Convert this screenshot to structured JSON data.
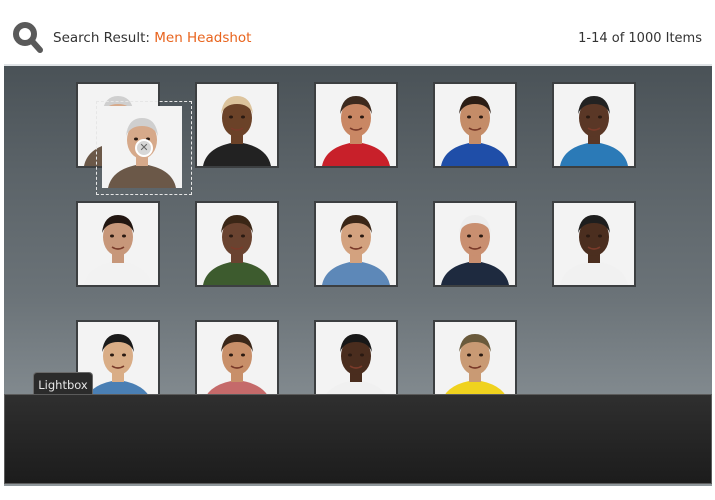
{
  "search": {
    "label": "Search Result:",
    "term": "Men Headshot",
    "count": "1-14 of 1000 Items"
  },
  "lightbox": {
    "label": "Lightbox"
  },
  "results": [
    {
      "name": "thumb-man-gray-hair",
      "skin": "#d6a98a",
      "hair": "#cfcfcf",
      "shirt": "#6b5848",
      "bg": "#f3f3f3"
    },
    {
      "name": "thumb-man-straw-hat",
      "skin": "#6b4228",
      "hair": "#dcc39c",
      "shirt": "#222222",
      "bg": "#f3f3f3"
    },
    {
      "name": "thumb-man-red-shirt",
      "skin": "#c98764",
      "hair": "#3d2a1e",
      "shirt": "#c8202a",
      "bg": "#f3f3f3"
    },
    {
      "name": "thumb-man-blue-jersey",
      "skin": "#c48c68",
      "hair": "#2b1d15",
      "shirt": "#1f4ea8",
      "bg": "#f3f3f3"
    },
    {
      "name": "thumb-man-dreadlocks-blue",
      "skin": "#5a3726",
      "hair": "#222222",
      "shirt": "#2b7ab7",
      "bg": "#f3f3f3"
    },
    {
      "name": "thumb-man-white-shirt",
      "skin": "#c7977a",
      "hair": "#221611",
      "shirt": "#f2f2f2",
      "bg": "#f3f3f3"
    },
    {
      "name": "thumb-man-striped-shirt",
      "skin": "#6a4330",
      "hair": "#3a2616",
      "shirt": "#3d5b2e",
      "bg": "#f3f3f3"
    },
    {
      "name": "thumb-man-denim-shirt",
      "skin": "#d3a27f",
      "hair": "#3a2617",
      "shirt": "#5d88b8",
      "bg": "#f3f3f3"
    },
    {
      "name": "thumb-man-white-mustache",
      "skin": "#c98f70",
      "hair": "#ededed",
      "shirt": "#1e2a3f",
      "bg": "#f3f3f3"
    },
    {
      "name": "thumb-man-long-dreads",
      "skin": "#4b2e1f",
      "hair": "#1e1e1e",
      "shirt": "#f1f1f1",
      "bg": "#f3f3f3"
    },
    {
      "name": "thumb-man-patterned-shirt",
      "skin": "#d9ad86",
      "hair": "#1a1a1a",
      "shirt": "#4a7fb4",
      "bg": "#f3f3f3"
    },
    {
      "name": "thumb-man-pink-shirt",
      "skin": "#c88f69",
      "hair": "#3a2719",
      "shirt": "#c56a6a",
      "bg": "#f3f3f3"
    },
    {
      "name": "thumb-man-tank-top",
      "skin": "#4a2d1e",
      "hair": "#181818",
      "shirt": "#f0f0f0",
      "bg": "#f3f3f3"
    },
    {
      "name": "thumb-man-cap-yellow",
      "skin": "#c99a74",
      "hair": "#6a5a3c",
      "shirt": "#f0d21e",
      "bg": "#f3f3f3"
    }
  ],
  "drag": {
    "remove_symbol": "✕"
  }
}
